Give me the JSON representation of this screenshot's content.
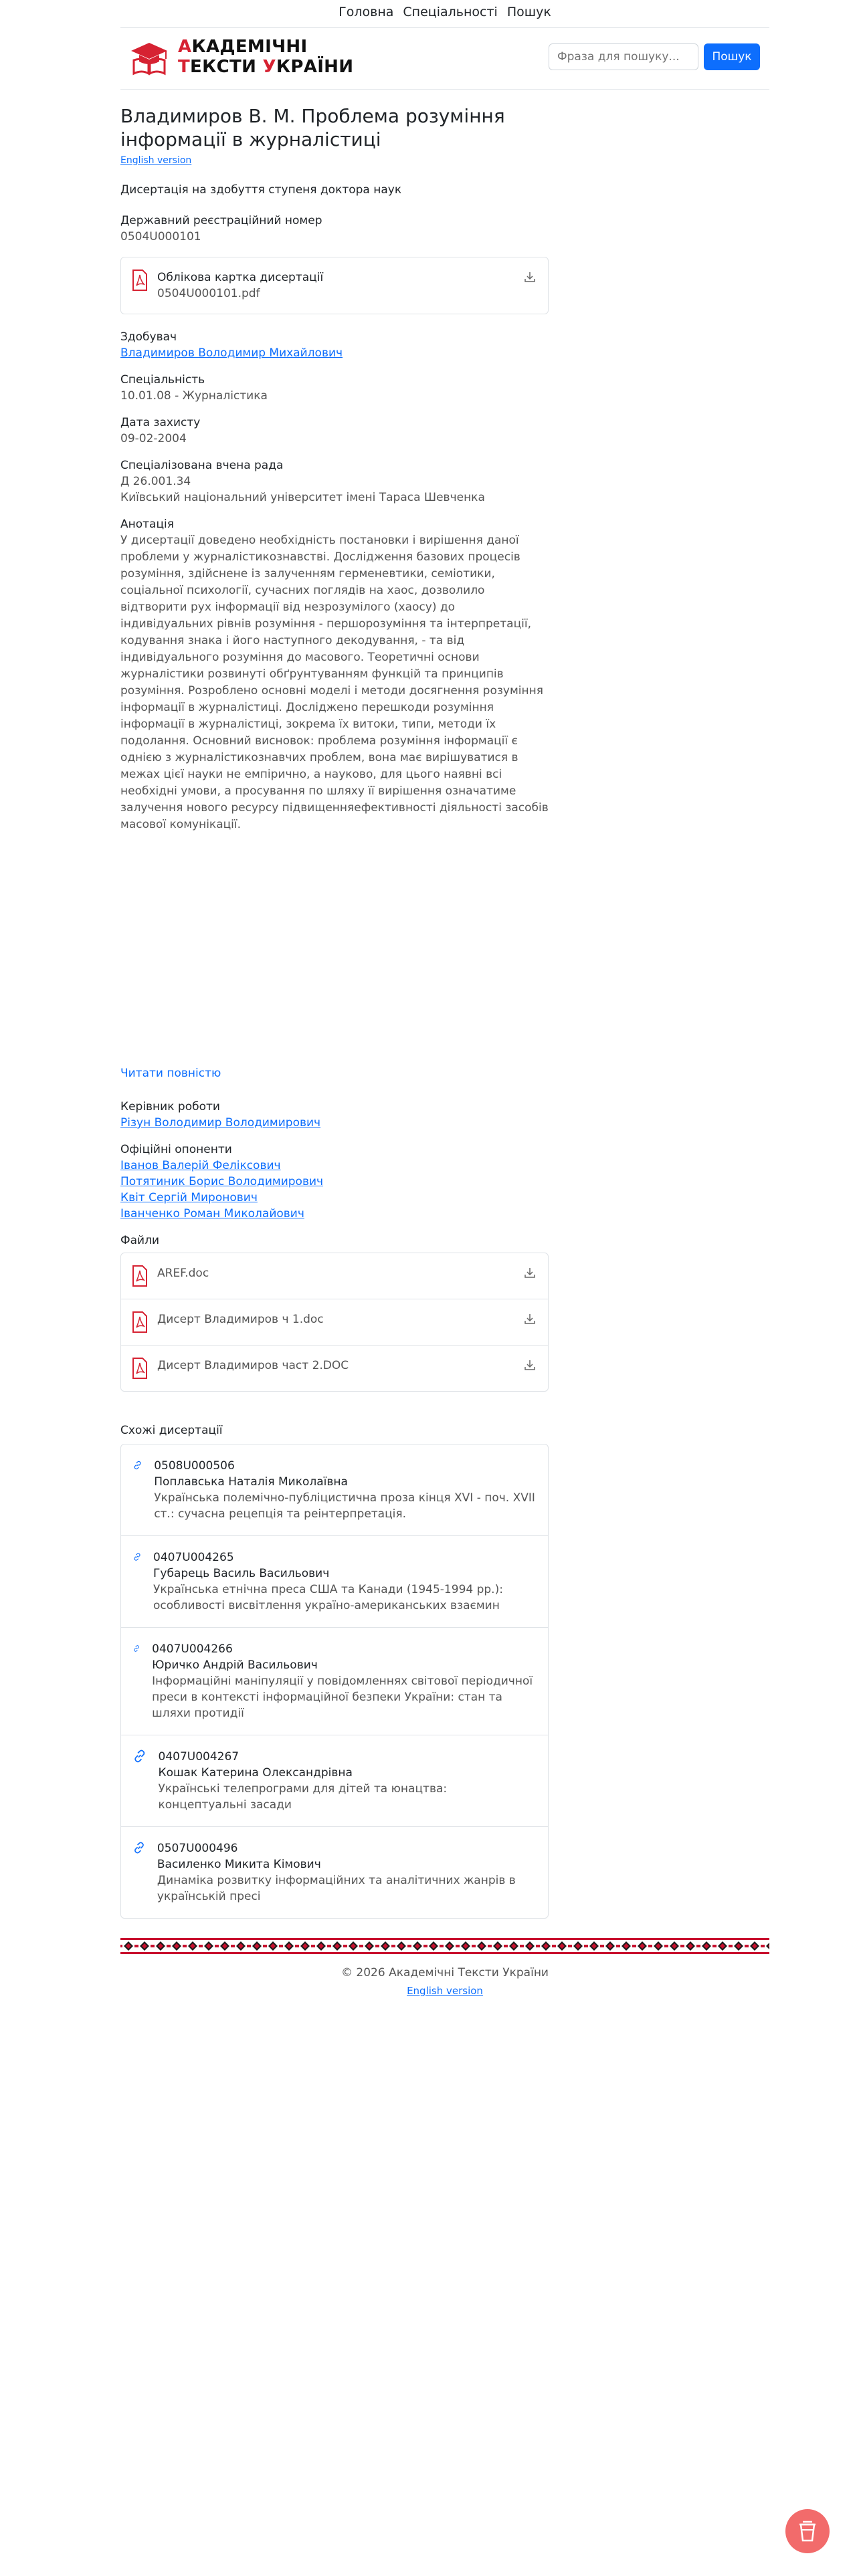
{
  "nav": {
    "items": [
      "Головна",
      "Спеціальності",
      "Пошук"
    ]
  },
  "logo": {
    "line1_first": "А",
    "line1_rest": "КАДЕМІЧНІ",
    "line2_a": "Т",
    "line2_b": "ЕКСТИ ",
    "line2_c": "У",
    "line2_d": "КРАЇНИ"
  },
  "search": {
    "placeholder": "Фраза для пошуку...",
    "button": "Пошук"
  },
  "page": {
    "title": "Владимиров В. М. Проблема розуміння інформації в журналістиці",
    "english_link": "English version",
    "degree": "Дисертація на здобуття ступеня доктора наук",
    "reg_label": "Державний реєстраційний номер",
    "reg_value": "0504U000101",
    "card_title": "Облікова картка дисертації",
    "card_file": "0504U000101.pdf",
    "applicant_label": "Здобувач",
    "applicant": "Владимиров Володимир Михайлович",
    "specialty_label": "Спеціальність",
    "specialty": "10.01.08 - Журналістика",
    "defense_label": "Дата захисту",
    "defense_date": "09-02-2004",
    "council_label": "Спеціалізована вчена рада",
    "council_code": "Д 26.001.34",
    "council_uni": "Київський національний університет імені Тараса Шевченка",
    "abstract_label": "Анотація",
    "abstract": "У дисертації доведено необхідність постановки і вирішення даної проблеми у журналістикознавстві. Дослідження базових процесів розуміння, здійснене із залученням герменевтики, семіотики, соціальної психології, сучасних поглядів на хаос, дозволило відтворити рух інформації від незрозумілого (хаосу) до індивідуальних рівнів розуміння - першорозуміння та інтерпретації, кодування знака і його наступного декодування, - та від індивідуального розуміння до масового. Теоретичні основи журналістики розвинуті обґрунтуванням функцій та принципів розуміння. Розроблено основні моделі і методи досягнення розуміння інформації в журналістиці. Досліджено перешкоди розуміння інформації в журналістиці, зокрема їх витоки, типи, методи їх подолання. Основний висновок: проблема розуміння інформації є однією з журналістикознавчих проблем, вона має вирішуватися в межах цієї науки не емпірично, а науково, для цього наявні всі необхідні умови, а просування по шляху її вирішення означатиме залучення нового ресурсу підвищенняефективності діяльності засобів масової комунікації.",
    "read_more": "Читати повністю",
    "supervisor_label": "Керівник роботи",
    "supervisor": "Різун Володимир Володимирович",
    "opponents_label": "Офіційні опоненти",
    "opponents": [
      "Іванов Валерій Феліксович",
      "Потятиник Борис Володимирович",
      "Квіт Сергій Миронович",
      "Іванченко Роман Миколайович"
    ],
    "files_label": "Файли",
    "files": [
      "AREF.doc",
      "Дисерт Владимиров ч 1.doc",
      "Дисерт Владимиров част 2.DOC"
    ],
    "similar_label": "Схожі дисертації",
    "similar": [
      {
        "code": "0508U000506",
        "author": "Поплавська Наталія Миколаївна",
        "title": "Українська полемічно-публіцистична проза кінця XVI - поч. XVII ст.: сучасна рецепція та реінтерпретація."
      },
      {
        "code": "0407U004265",
        "author": "Губарець Василь Васильович",
        "title": "Українська етнічна преса США та Канади (1945-1994 рр.): особливості висвітлення україно-американських взаємин"
      },
      {
        "code": "0407U004266",
        "author": "Юричко Андрій Васильович",
        "title": "Інформаційні маніпуляції у повідомленнях світової періодичної преси в контексті інформаційної безпеки України: стан та шляхи протидії"
      },
      {
        "code": "0407U004267",
        "author": "Кошак Катерина Олександрівна",
        "title": "Українські телепрограми для дітей та юнацтва: концептуальні засади"
      },
      {
        "code": "0507U000496",
        "author": "Василенко Микита Кімович",
        "title": "Динаміка розвитку інформаційних та аналітичних жанрів в українській пресі"
      }
    ]
  },
  "footer": {
    "copyright": "© 2026 Академічні Тексти України",
    "english_link": "English version"
  },
  "icons": {
    "pdf": "pdf-file-icon",
    "download": "download-icon",
    "link": "link-icon",
    "fab": "coffee-cup-icon"
  },
  "colors": {
    "accent": "#0d6efd",
    "brand_red": "#d62232",
    "fab": "#f26b6b"
  }
}
